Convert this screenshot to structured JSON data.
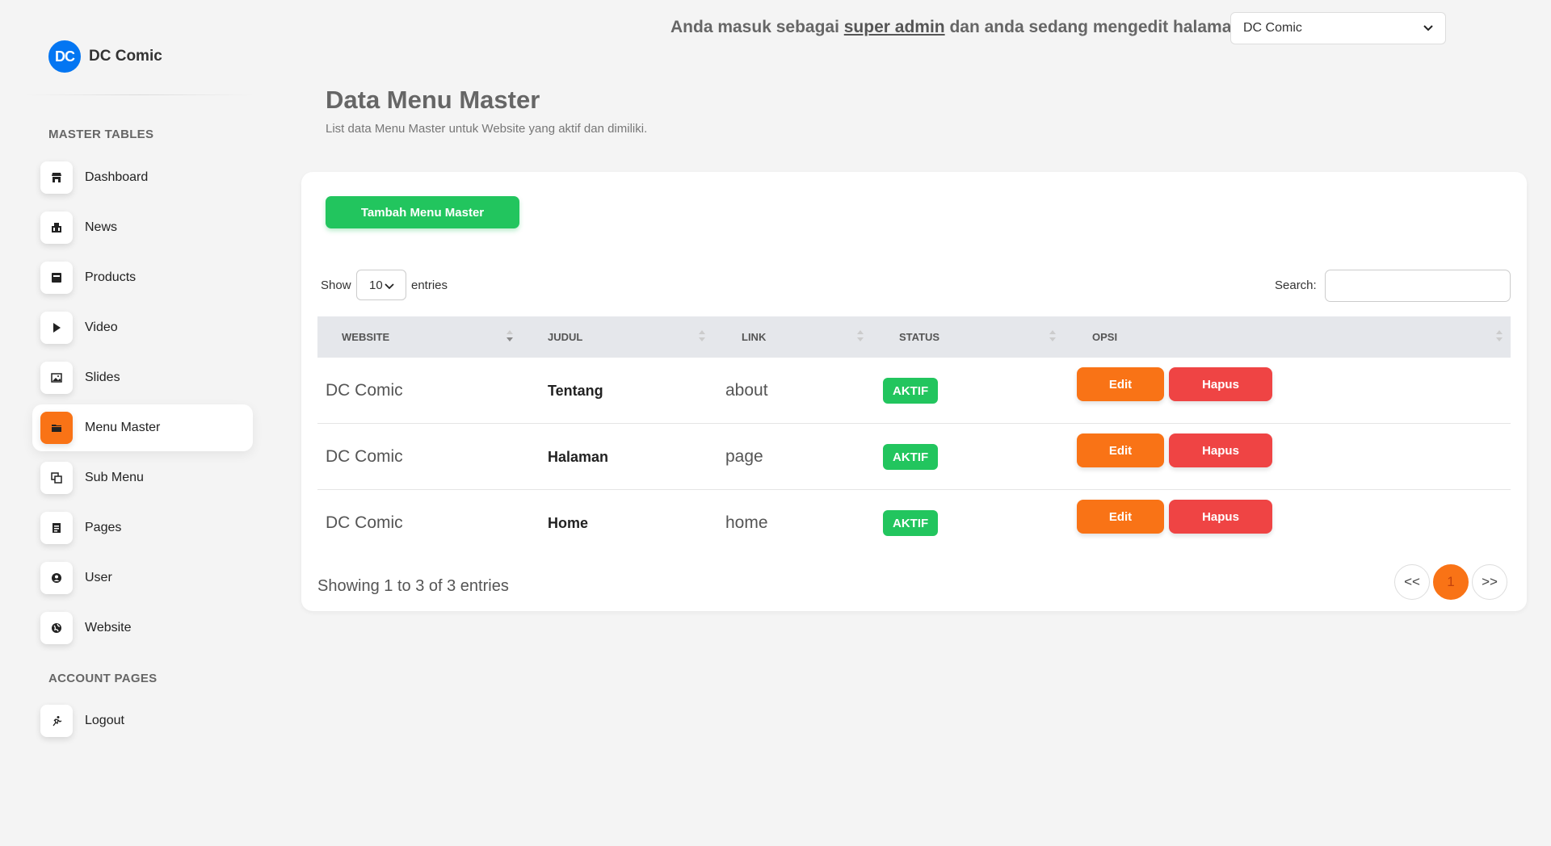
{
  "brand": {
    "name": "DC Comic",
    "logo_text": "DC"
  },
  "sidebar": {
    "section_master": "MASTER TABLES",
    "items": [
      {
        "label": "Dashboard",
        "icon": "store-icon"
      },
      {
        "label": "News",
        "icon": "newspaper-icon"
      },
      {
        "label": "Products",
        "icon": "box-icon"
      },
      {
        "label": "Video",
        "icon": "play-icon"
      },
      {
        "label": "Slides",
        "icon": "image-icon"
      },
      {
        "label": "Menu Master",
        "icon": "folder-icon",
        "active": true
      },
      {
        "label": "Sub Menu",
        "icon": "copy-icon"
      },
      {
        "label": "Pages",
        "icon": "document-icon"
      },
      {
        "label": "User",
        "icon": "user-circle-icon"
      },
      {
        "label": "Website",
        "icon": "globe-icon"
      }
    ],
    "section_account": "ACCOUNT PAGES",
    "account_items": [
      {
        "label": "Logout",
        "icon": "run-icon"
      }
    ]
  },
  "header": {
    "prefix": "Anda masuk sebagai ",
    "role": "super admin",
    "suffix": " dan anda sedang mengedit halaman",
    "site_select": "DC Comic"
  },
  "page": {
    "title": "Data Menu Master",
    "subtitle": "List data Menu Master untuk Website yang aktif dan dimiliki."
  },
  "card": {
    "add_button": "Tambah Menu Master",
    "show_label": "Show",
    "entries_value": "10",
    "entries_label": "entries",
    "search_label": "Search:",
    "search_value": ""
  },
  "table": {
    "columns": [
      "WEBSITE",
      "JUDUL",
      "LINK",
      "STATUS",
      "OPSI"
    ],
    "rows": [
      {
        "website": "DC Comic",
        "judul": "Tentang",
        "link": "about",
        "status": "AKTIF"
      },
      {
        "website": "DC Comic",
        "judul": "Halaman",
        "link": "page",
        "status": "AKTIF"
      },
      {
        "website": "DC Comic",
        "judul": "Home",
        "link": "home",
        "status": "AKTIF"
      }
    ],
    "edit_label": "Edit",
    "delete_label": "Hapus"
  },
  "footer": {
    "info": "Showing 1 to 3 of 3 entries",
    "prev": "<<",
    "page": "1",
    "next": ">>"
  },
  "colors": {
    "accent": "#f97316",
    "success": "#22c55e",
    "danger": "#ef4444",
    "brand": "#0476F2"
  }
}
